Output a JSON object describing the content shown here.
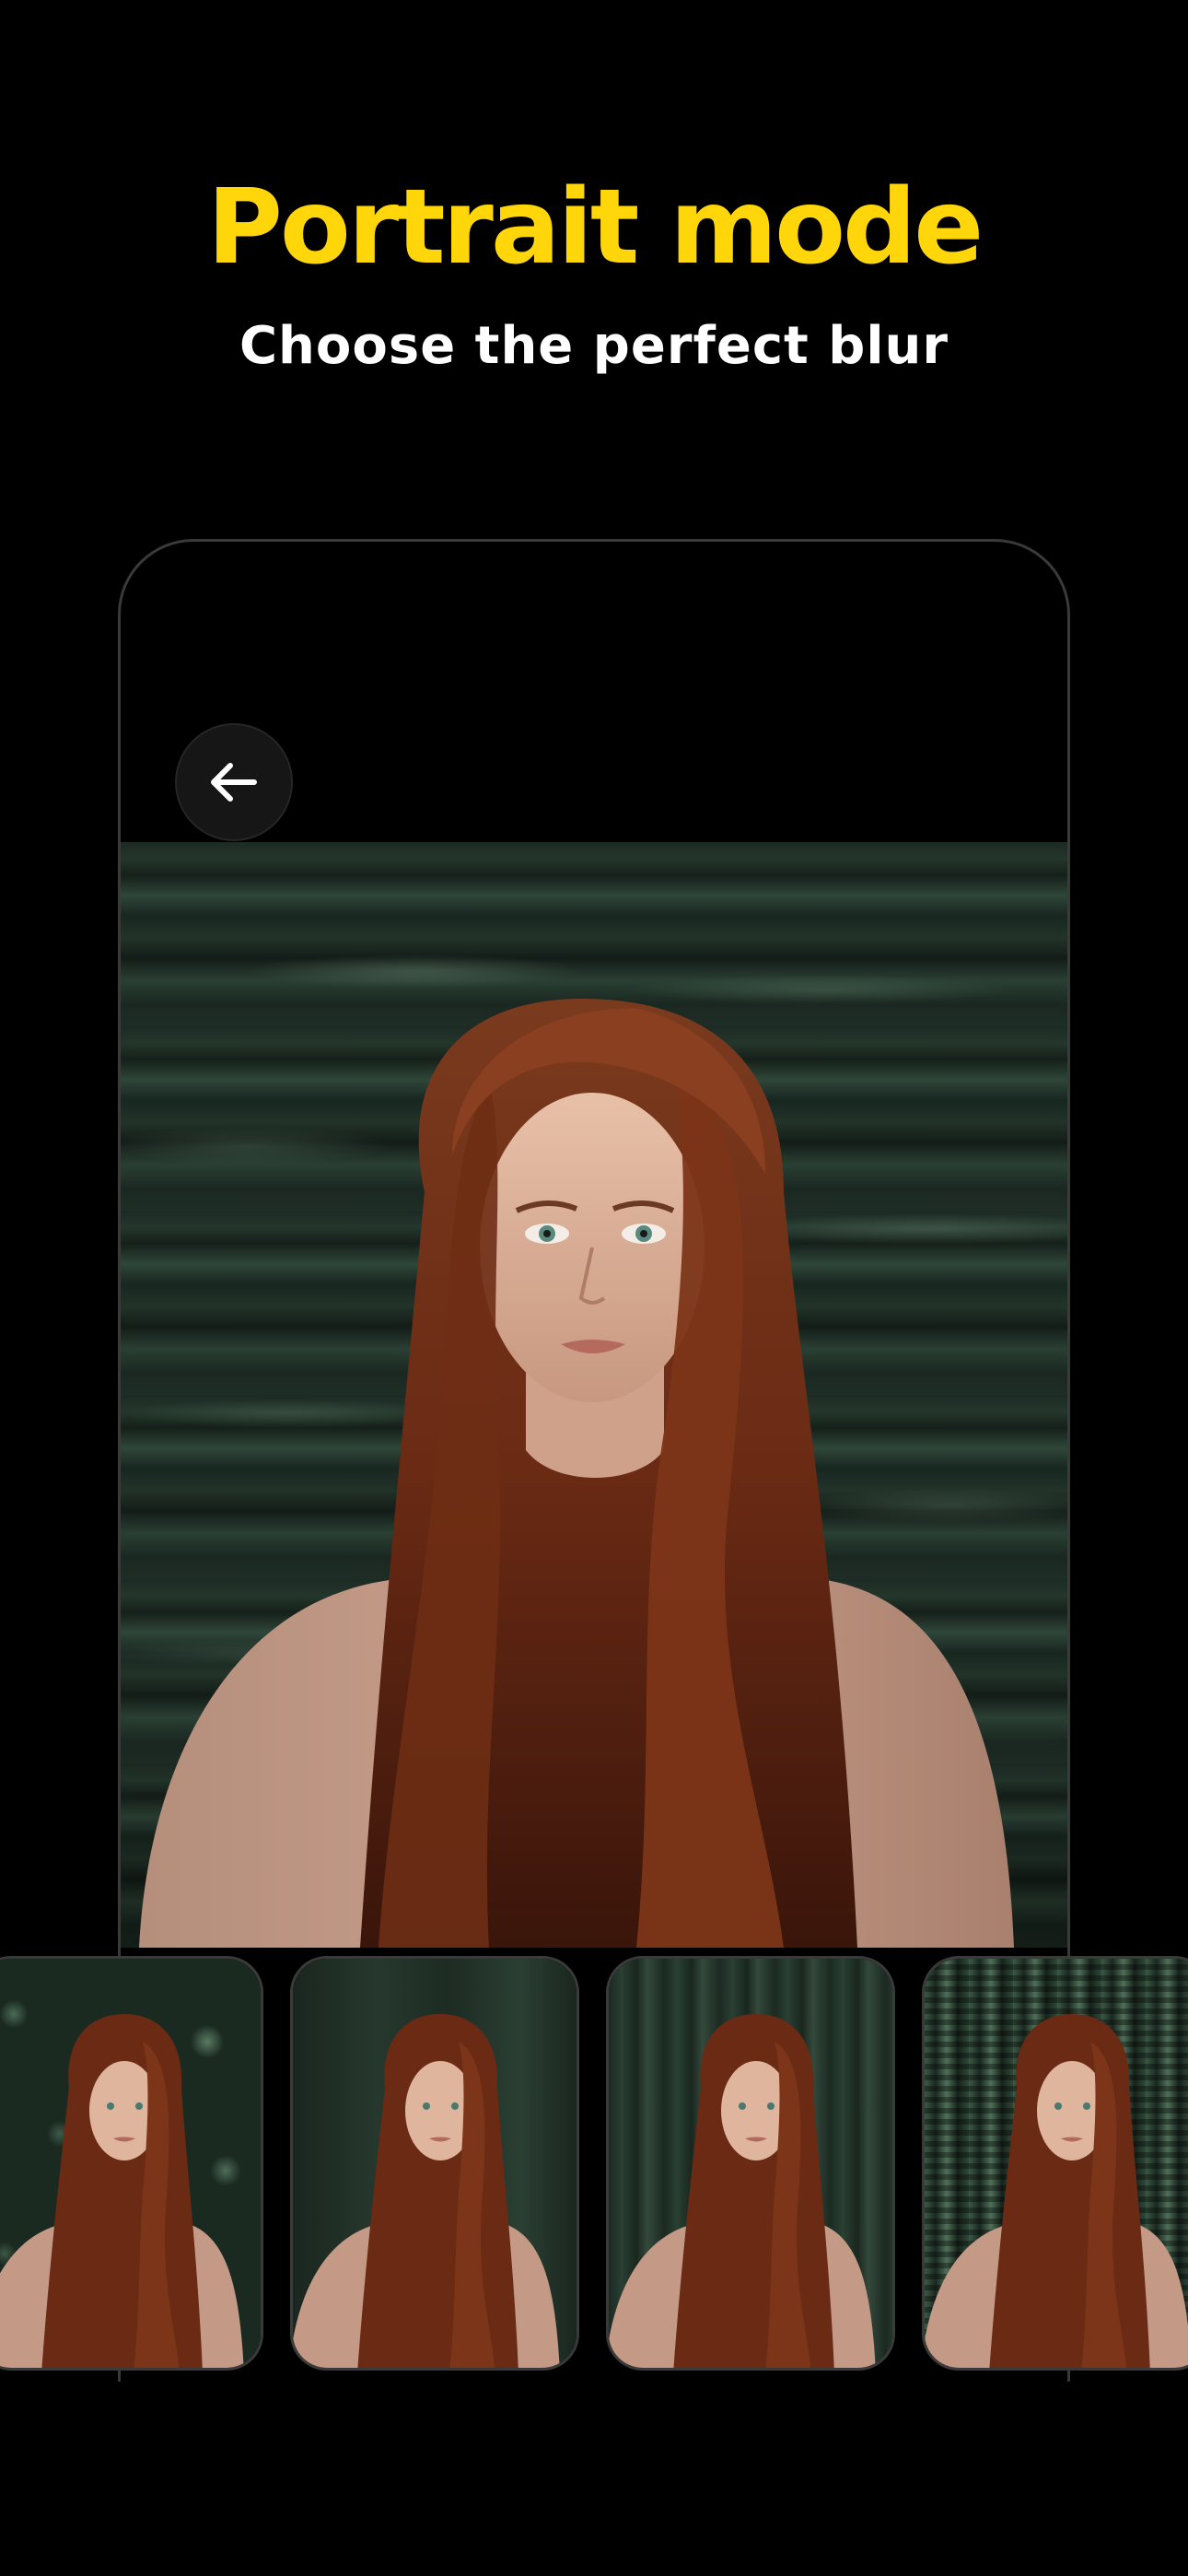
{
  "headline": {
    "title": "Portrait mode",
    "subtitle": "Choose the perfect blur"
  },
  "colors": {
    "background": "#000000",
    "title": "#FFD60A",
    "subtitle": "#FFFFFF",
    "device_border": "#3a3a3a",
    "back_button_bg": "#161616"
  },
  "device": {
    "back_button_icon": "arrow-left-icon",
    "preview_effect": "motion-blur"
  },
  "blur_options": [
    {
      "effect": "bokeh-blur"
    },
    {
      "effect": "soft-blur"
    },
    {
      "effect": "vertical-blur"
    },
    {
      "effect": "pixelated-blur"
    }
  ]
}
